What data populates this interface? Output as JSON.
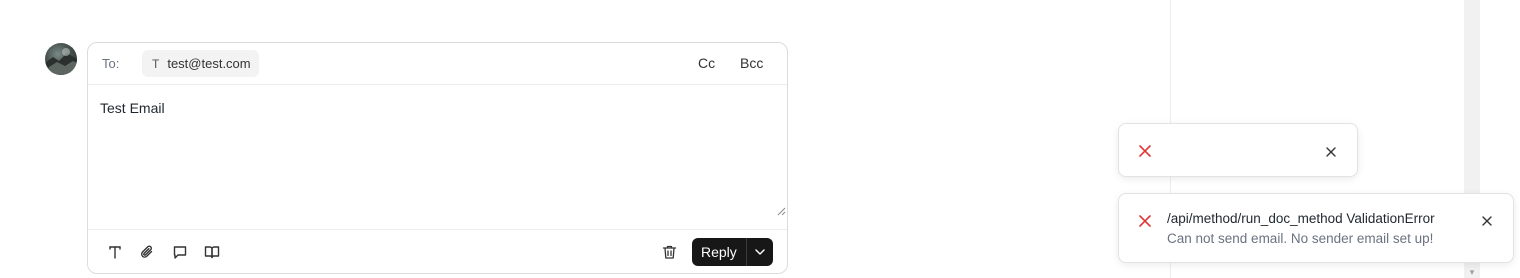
{
  "composer": {
    "to_label": "To:",
    "recipients": [
      {
        "initial": "T",
        "email": "test@test.com"
      }
    ],
    "cc_label": "Cc",
    "bcc_label": "Bcc",
    "body_text": "Test Email",
    "toolbar_icons": [
      "text-format-icon",
      "attachment-icon",
      "comment-icon",
      "template-icon"
    ],
    "reply_label": "Reply"
  },
  "toasts": [
    {
      "type": "error",
      "title": "",
      "message": ""
    },
    {
      "type": "error",
      "title": "/api/method/run_doc_method ValidationError",
      "message": "Can not send email. No sender email set up!"
    }
  ],
  "colors": {
    "error": "#e03636",
    "reply_button_bg": "#171717",
    "border": "#dcdcdc"
  }
}
